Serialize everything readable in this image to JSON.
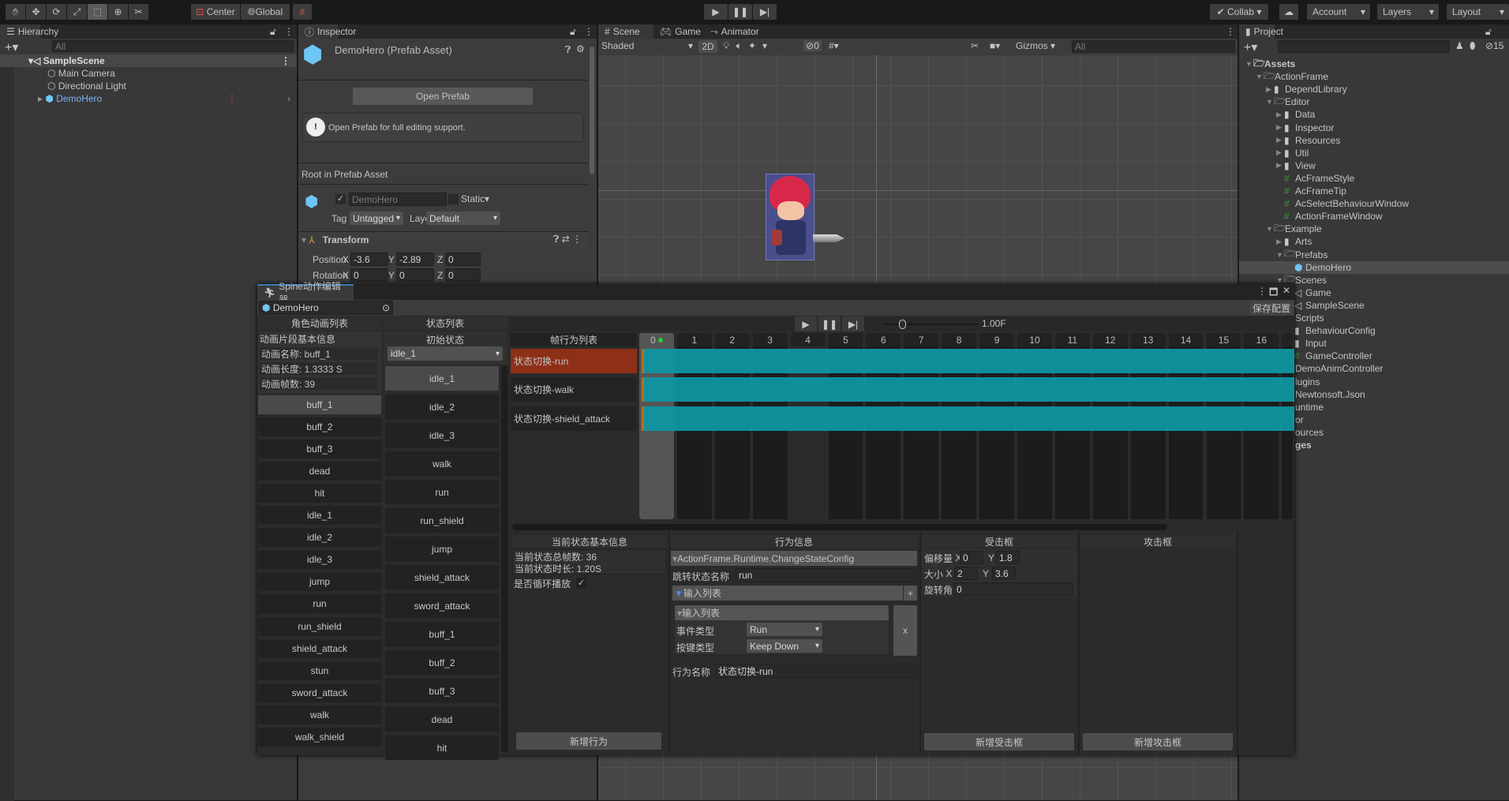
{
  "toolbar": {
    "center": "Center",
    "global": "Global",
    "collab": "Collab",
    "account": "Account",
    "layers": "Layers",
    "layout": "Layout",
    "tools": [
      "hand-icon",
      "move-icon",
      "rotate-icon",
      "scale-icon",
      "rect-icon",
      "transform-icon",
      "custom-tool-icon"
    ]
  },
  "hierarchy": {
    "tab": "Hierarchy",
    "search_placeholder": "All",
    "scene": "SampleScene",
    "items": [
      "Main Camera",
      "Directional Light",
      "DemoHero"
    ]
  },
  "inspector": {
    "tab": "Inspector",
    "title": "DemoHero (Prefab Asset)",
    "open_prefab": "Open Prefab",
    "help": "Open Prefab for full editing support.",
    "root_label": "Root in Prefab Asset",
    "name": "DemoHero",
    "static": "Static",
    "tag_label": "Tag",
    "tag": "Untagged",
    "layer_label": "Layer",
    "layer": "Default",
    "transform": "Transform",
    "position_label": "Position",
    "rotation_label": "Rotation",
    "position": {
      "x": "-3.6",
      "y": "-2.89",
      "z": "0"
    },
    "rotation": {
      "x": "0",
      "y": "0",
      "z": "0"
    }
  },
  "scene": {
    "tabs": [
      "Scene",
      "Game",
      "Animator"
    ],
    "shading": "Shaded",
    "mode_2d": "2D",
    "hidden_count": "0",
    "gizmos": "Gizmos",
    "search_placeholder": "All"
  },
  "project": {
    "tab": "Project",
    "hidden_count": "15",
    "tree": [
      {
        "t": "Assets",
        "d": 0,
        "i": "folder-open",
        "b": true,
        "a": "▼"
      },
      {
        "t": "ActionFrame",
        "d": 1,
        "i": "folder-open",
        "a": "▼"
      },
      {
        "t": "DependLibrary",
        "d": 2,
        "i": "folder",
        "a": "▶"
      },
      {
        "t": "Editor",
        "d": 2,
        "i": "folder-open",
        "a": "▼"
      },
      {
        "t": "Data",
        "d": 3,
        "i": "folder",
        "a": "▶"
      },
      {
        "t": "Inspector",
        "d": 3,
        "i": "folder",
        "a": "▶"
      },
      {
        "t": "Resources",
        "d": 3,
        "i": "folder",
        "a": "▶"
      },
      {
        "t": "Util",
        "d": 3,
        "i": "folder",
        "a": "▶"
      },
      {
        "t": "View",
        "d": 3,
        "i": "folder",
        "a": "▶"
      },
      {
        "t": "AcFrameStyle",
        "d": 3,
        "i": "script"
      },
      {
        "t": "AcFrameTip",
        "d": 3,
        "i": "script"
      },
      {
        "t": "AcSelectBehaviourWindow",
        "d": 3,
        "i": "script"
      },
      {
        "t": "ActionFrameWindow",
        "d": 3,
        "i": "script"
      },
      {
        "t": "Example",
        "d": 2,
        "i": "folder-open",
        "a": "▼"
      },
      {
        "t": "Arts",
        "d": 3,
        "i": "folder",
        "a": "▶"
      },
      {
        "t": "Prefabs",
        "d": 3,
        "i": "folder-open",
        "a": "▼"
      },
      {
        "t": "DemoHero",
        "d": 4,
        "i": "prefab",
        "sel": true
      },
      {
        "t": "Scenes",
        "d": 3,
        "i": "folder-open",
        "a": "▼"
      },
      {
        "t": "Game",
        "d": 4,
        "i": "scene"
      },
      {
        "t": "SampleScene",
        "d": 4,
        "i": "scene"
      },
      {
        "t": "Scripts",
        "d": 3,
        "i": "folder-open",
        "clip": true
      },
      {
        "t": "BehaviourConfig",
        "d": 4,
        "i": "folder"
      },
      {
        "t": "Input",
        "d": 4,
        "i": "folder"
      },
      {
        "t": "GameController",
        "d": 4,
        "i": "script"
      },
      {
        "t": "DemoAnimController",
        "d": 3,
        "i": "script",
        "clip": true
      },
      {
        "t": "lugins",
        "d": 2,
        "clip": true
      },
      {
        "t": "Newtonsoft.Json",
        "d": 3,
        "clip": true
      },
      {
        "t": "untime",
        "d": 2,
        "clip": true
      },
      {
        "t": "or",
        "d": 2,
        "clip": true
      },
      {
        "t": "ources",
        "d": 2,
        "clip": true
      },
      {
        "t": "ges",
        "d": 1,
        "b": true,
        "clip": true
      }
    ]
  },
  "editor": {
    "title": "Spine动作编辑器",
    "object": "DemoHero",
    "save": "保存配置",
    "speed": "1.00F",
    "playback_position": 0.2,
    "anim_header": "角色动画列表",
    "clip_info_header": "动画片段基本信息",
    "clip_name": "动画名称: buff_1",
    "clip_length": "动画长度: 1.3333 S",
    "clip_frames": "动画帧数: 39",
    "animations": [
      "buff_1",
      "buff_2",
      "buff_3",
      "dead",
      "hit",
      "idle_1",
      "idle_2",
      "idle_3",
      "jump",
      "run",
      "run_shield",
      "shield_attack",
      "stun",
      "sword_attack",
      "walk",
      "walk_shield"
    ],
    "selected_animation": "buff_1",
    "state_header": "状态列表",
    "initial_state_label": "初始状态",
    "initial_state": "idle_1",
    "states": [
      "idle_1",
      "idle_2",
      "idle_3",
      "walk",
      "run",
      "run_shield",
      "jump",
      "shield_attack",
      "sword_attack",
      "buff_1",
      "buff_2",
      "buff_3",
      "dead",
      "hit"
    ],
    "selected_state": "idle_1",
    "behavior_header": "帧行为列表",
    "behaviors": [
      "状态切换-run",
      "状态切换-walk",
      "状态切换-shield_attack"
    ],
    "selected_behavior": "状态切换-run",
    "frames": [
      "0",
      "1",
      "2",
      "3",
      "4",
      "5",
      "6",
      "7",
      "8",
      "9",
      "10",
      "11",
      "12",
      "13",
      "14",
      "15",
      "16"
    ],
    "current_frame": "0",
    "state_info": {
      "header": "当前状态基本信息",
      "total_frames": "当前状态总帧数: 36",
      "duration": "当前状态时长: 1.20S",
      "loop_label": "是否循环播放",
      "loop": true,
      "add_behavior": "新增行为"
    },
    "behavior_info": {
      "header": "行为信息",
      "config": "ActionFrame.Runtime.ChangeStateConfig",
      "jump_label": "跳转状态名称",
      "jump_value": "run",
      "input_list": "输入列表",
      "input_item": "输入列表",
      "event_label": "事件类型",
      "event_value": "Run",
      "key_label": "按键类型",
      "key_value": "Keep Down",
      "add": "+",
      "remove": "x",
      "name_label": "行为名称",
      "name_value": "状态切换-run"
    },
    "hurt_box": {
      "header": "受击框",
      "offset_label": "偏移量",
      "offset_x": "0",
      "offset_y": "1.8",
      "size_label": "大小",
      "size_x": "2",
      "size_y": "3.6",
      "rot_label": "旋转角",
      "rot": "0",
      "add": "新增受击框"
    },
    "attack_box": {
      "header": "攻击框",
      "add": "新增攻击框"
    }
  },
  "colors": {
    "accent_row": "#8e2f17",
    "timeline_bar": "#0d97a3",
    "selection": "#4d4d4d",
    "prefab_blue": "#6ec6f5"
  }
}
